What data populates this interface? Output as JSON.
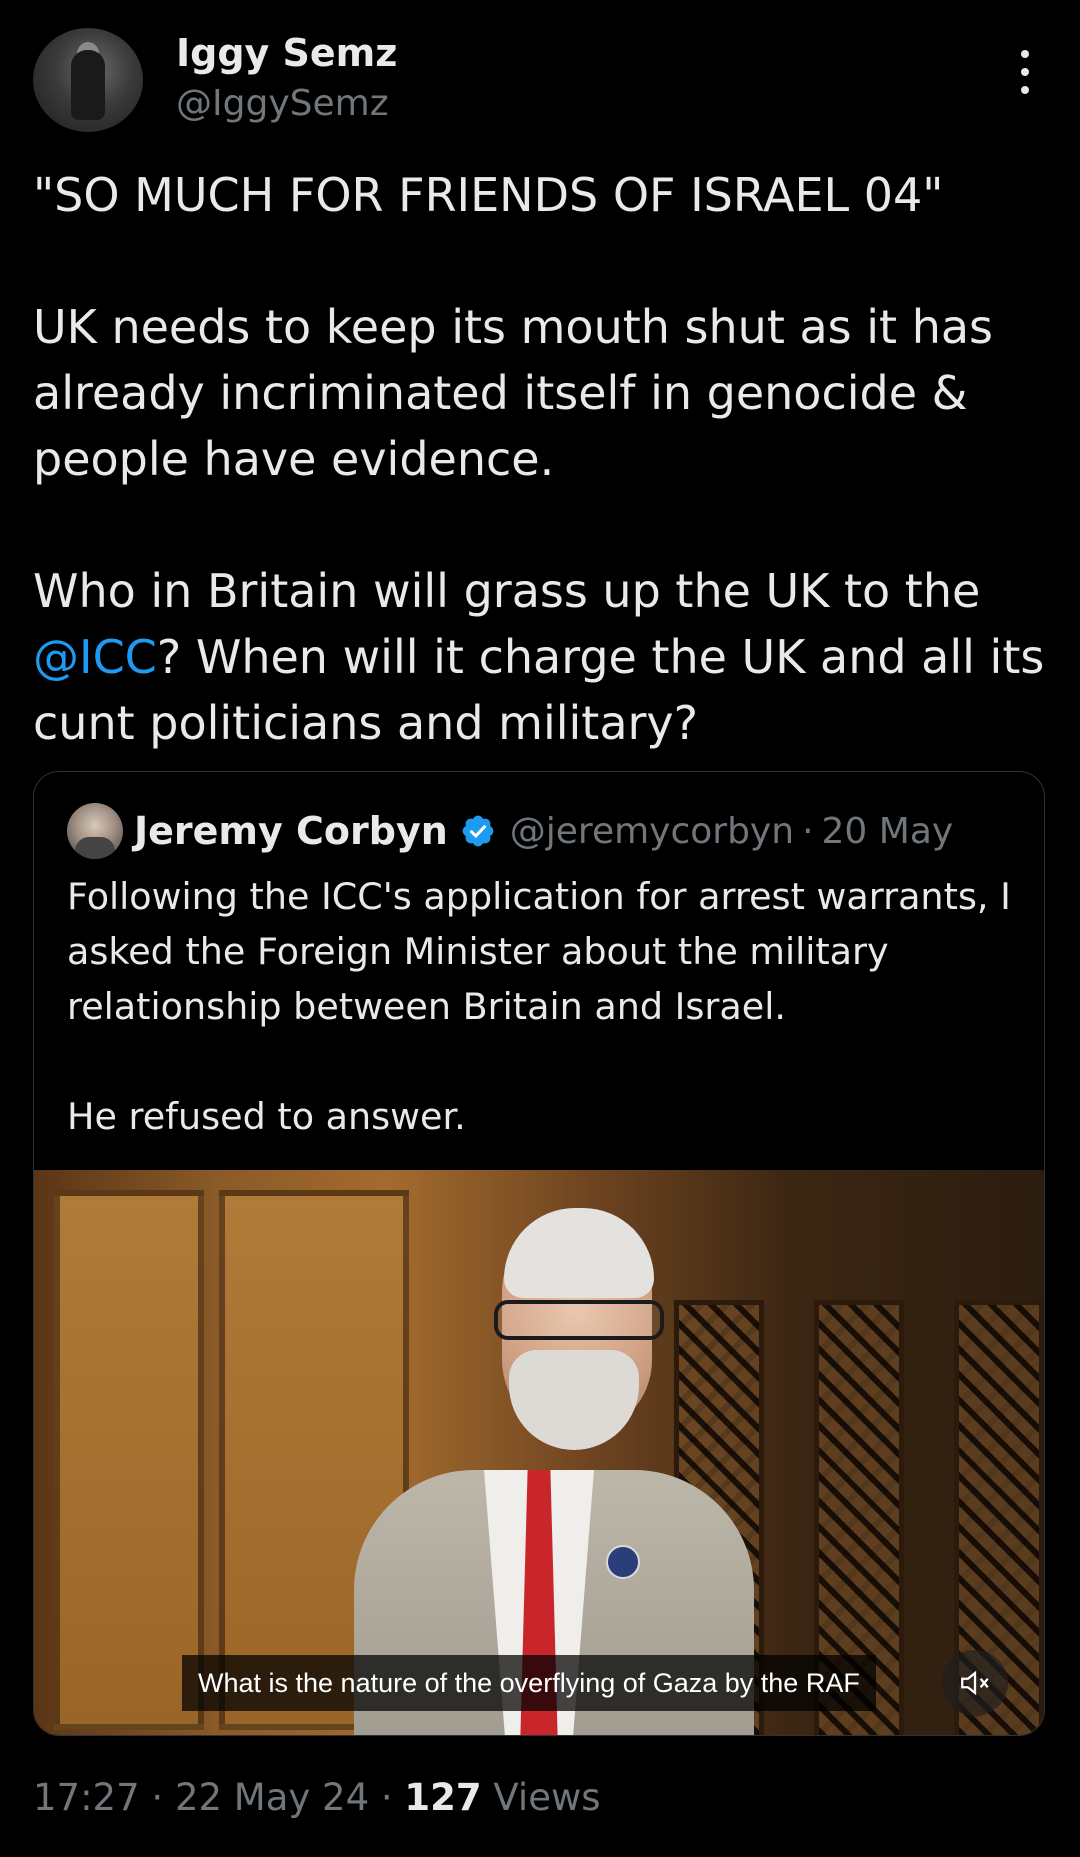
{
  "author": {
    "display_name": "Iggy Semz",
    "handle": "@IggySemz"
  },
  "tweet": {
    "line1": "\"SO MUCH FOR FRIENDS OF ISRAEL 04\"",
    "para2": "UK needs to keep its mouth shut as it has already incriminated itself in genocide & people have evidence.",
    "para3_before": "Who in Britain will grass up the UK to the ",
    "para3_mention": "@ICC",
    "para3_after": "? When will it charge the UK and all its cunt politicians and military?"
  },
  "quote": {
    "display_name": "Jeremy Corbyn",
    "handle": "@jeremycorbyn",
    "separator": "·",
    "date": "20 May",
    "text1": "Following the ICC's application for arrest warrants, I asked the Foreign Minister about the military relationship between Britain and Israel.",
    "text2": "He refused to answer.",
    "video_caption": "What is the nature of the overflying of Gaza by the RAF"
  },
  "footer": {
    "time": "17:27",
    "sep1": " · ",
    "date": "22 May 24",
    "sep2": " · ",
    "views_count": "127",
    "views_label": " Views"
  },
  "colors": {
    "background": "#000000",
    "text": "#e7e9ea",
    "muted": "#71767b",
    "link": "#1d9bf0",
    "border": "#2f3336",
    "verified": "#1d9bf0"
  },
  "icons": {
    "more": "more-vertical-icon",
    "verified": "verified-badge-icon",
    "mute": "muted-speaker-icon"
  }
}
